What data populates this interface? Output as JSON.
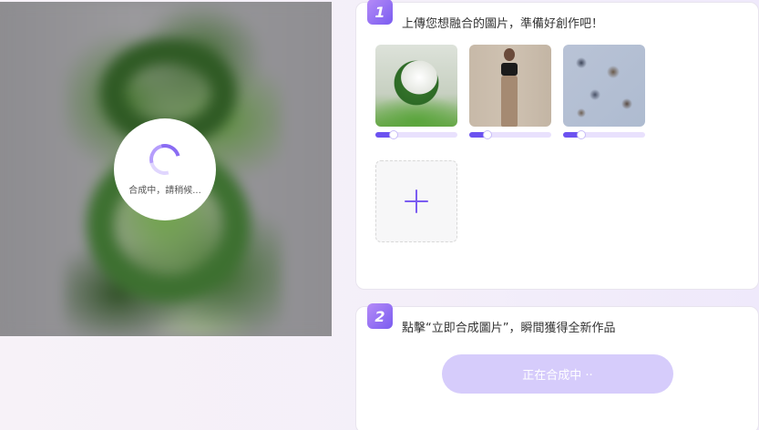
{
  "preview": {
    "loading_text": "合成中，請稍候..."
  },
  "step1": {
    "number": "1",
    "title": "上傳您想融合的圖片，準備好創作吧！",
    "images": [
      {
        "name": "green-spiral-image",
        "strength": 0.22
      },
      {
        "name": "fashion-model-image",
        "strength": 0.22
      },
      {
        "name": "dried-flowers-image",
        "strength": 0.22
      }
    ],
    "add_icon": "plus-icon"
  },
  "step2": {
    "number": "2",
    "title": "點擊“立即合成圖片”，瞬間獲得全新作品",
    "button_label": "正在合成中 ··"
  },
  "colors": {
    "accent": "#6c52f0",
    "badge_start": "#b58bf7",
    "badge_end": "#7a5cf0",
    "button_disabled": "#d6ccfb"
  }
}
